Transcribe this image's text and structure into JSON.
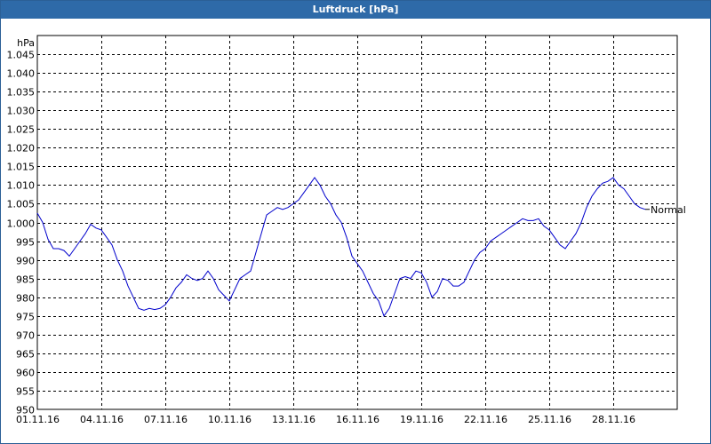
{
  "window": {
    "title": "Luftdruck [hPa]"
  },
  "chart_data": {
    "type": "line",
    "title": "Luftdruck [hPa]",
    "ylabel": "hPa",
    "xlabel": "",
    "ylim": [
      950,
      1050
    ],
    "y_ticks": [
      "950",
      "955",
      "960",
      "965",
      "970",
      "975",
      "980",
      "985",
      "990",
      "995",
      "1.000",
      "1.005",
      "1.010",
      "1.015",
      "1.020",
      "1.025",
      "1.030",
      "1.035",
      "1.040",
      "1.045"
    ],
    "x_ticks": [
      "01.11.16",
      "04.11.16",
      "07.11.16",
      "10.11.16",
      "13.11.16",
      "16.11.16",
      "19.11.16",
      "22.11.16",
      "25.11.16",
      "28.11.16"
    ],
    "x_range_days": [
      0,
      30
    ],
    "grid": true,
    "line_color": "#0000cc",
    "annotation": {
      "label": "Normal"
    },
    "series": [
      {
        "points": [
          [
            0.0,
            1002.5
          ],
          [
            0.25,
            1000
          ],
          [
            0.5,
            995.5
          ],
          [
            0.75,
            993
          ],
          [
            1.0,
            993
          ],
          [
            1.25,
            992.5
          ],
          [
            1.5,
            991
          ],
          [
            1.75,
            993
          ],
          [
            2.0,
            995
          ],
          [
            2.25,
            997
          ],
          [
            2.5,
            999.5
          ],
          [
            2.75,
            998.5
          ],
          [
            3.0,
            998
          ],
          [
            3.25,
            996
          ],
          [
            3.5,
            994
          ],
          [
            3.75,
            990
          ],
          [
            4.0,
            987
          ],
          [
            4.25,
            983
          ],
          [
            4.5,
            980
          ],
          [
            4.75,
            977
          ],
          [
            5.0,
            976.5
          ],
          [
            5.25,
            977
          ],
          [
            5.5,
            976.7
          ],
          [
            5.75,
            977
          ],
          [
            6.0,
            978
          ],
          [
            6.25,
            980
          ],
          [
            6.5,
            982.5
          ],
          [
            6.75,
            984
          ],
          [
            7.0,
            986
          ],
          [
            7.25,
            985
          ],
          [
            7.5,
            984.5
          ],
          [
            7.75,
            985
          ],
          [
            8.0,
            987
          ],
          [
            8.25,
            985
          ],
          [
            8.5,
            982
          ],
          [
            8.75,
            980.5
          ],
          [
            9.0,
            979
          ],
          [
            9.25,
            982
          ],
          [
            9.5,
            985
          ],
          [
            9.75,
            986
          ],
          [
            10.0,
            987
          ],
          [
            10.25,
            992
          ],
          [
            10.5,
            997
          ],
          [
            10.75,
            1002
          ],
          [
            11.0,
            1003
          ],
          [
            11.25,
            1004
          ],
          [
            11.5,
            1003.5
          ],
          [
            11.75,
            1004
          ],
          [
            12.0,
            1005
          ],
          [
            12.25,
            1006
          ],
          [
            12.5,
            1008
          ],
          [
            12.75,
            1010
          ],
          [
            13.0,
            1012
          ],
          [
            13.25,
            1010
          ],
          [
            13.5,
            1007
          ],
          [
            13.75,
            1005
          ],
          [
            14.0,
            1002
          ],
          [
            14.25,
            1000
          ],
          [
            14.5,
            996
          ],
          [
            14.75,
            991
          ],
          [
            15.0,
            989
          ],
          [
            15.25,
            987
          ],
          [
            15.5,
            984
          ],
          [
            15.75,
            981
          ],
          [
            16.0,
            979
          ],
          [
            16.25,
            975
          ],
          [
            16.5,
            977
          ],
          [
            16.75,
            981
          ],
          [
            17.0,
            985
          ],
          [
            17.25,
            985.5
          ],
          [
            17.5,
            985
          ],
          [
            17.75,
            987
          ],
          [
            18.0,
            986.5
          ],
          [
            18.25,
            984
          ],
          [
            18.5,
            980
          ],
          [
            18.75,
            981.5
          ],
          [
            19.0,
            985
          ],
          [
            19.25,
            984.5
          ],
          [
            19.5,
            983
          ],
          [
            19.75,
            983
          ],
          [
            20.0,
            984
          ],
          [
            20.25,
            987
          ],
          [
            20.5,
            990
          ],
          [
            20.75,
            992
          ],
          [
            21.0,
            993
          ],
          [
            21.25,
            995
          ],
          [
            21.5,
            996
          ],
          [
            21.75,
            997
          ],
          [
            22.0,
            998
          ],
          [
            22.25,
            999
          ],
          [
            22.5,
            1000
          ],
          [
            22.75,
            1001
          ],
          [
            23.0,
            1000.5
          ],
          [
            23.25,
            1000.5
          ],
          [
            23.5,
            1001
          ],
          [
            23.75,
            999
          ],
          [
            24.0,
            998
          ],
          [
            24.25,
            996
          ],
          [
            24.5,
            994
          ],
          [
            24.75,
            993
          ],
          [
            25.0,
            995
          ],
          [
            25.25,
            997
          ],
          [
            25.5,
            1000
          ],
          [
            25.75,
            1004
          ],
          [
            26.0,
            1007
          ],
          [
            26.25,
            1009
          ],
          [
            26.5,
            1010.5
          ],
          [
            26.75,
            1011
          ],
          [
            27.0,
            1012
          ],
          [
            27.25,
            1010
          ],
          [
            27.5,
            1009
          ],
          [
            27.75,
            1007
          ],
          [
            28.0,
            1005
          ],
          [
            28.25,
            1004
          ],
          [
            28.5,
            1003.5
          ]
        ]
      }
    ]
  }
}
